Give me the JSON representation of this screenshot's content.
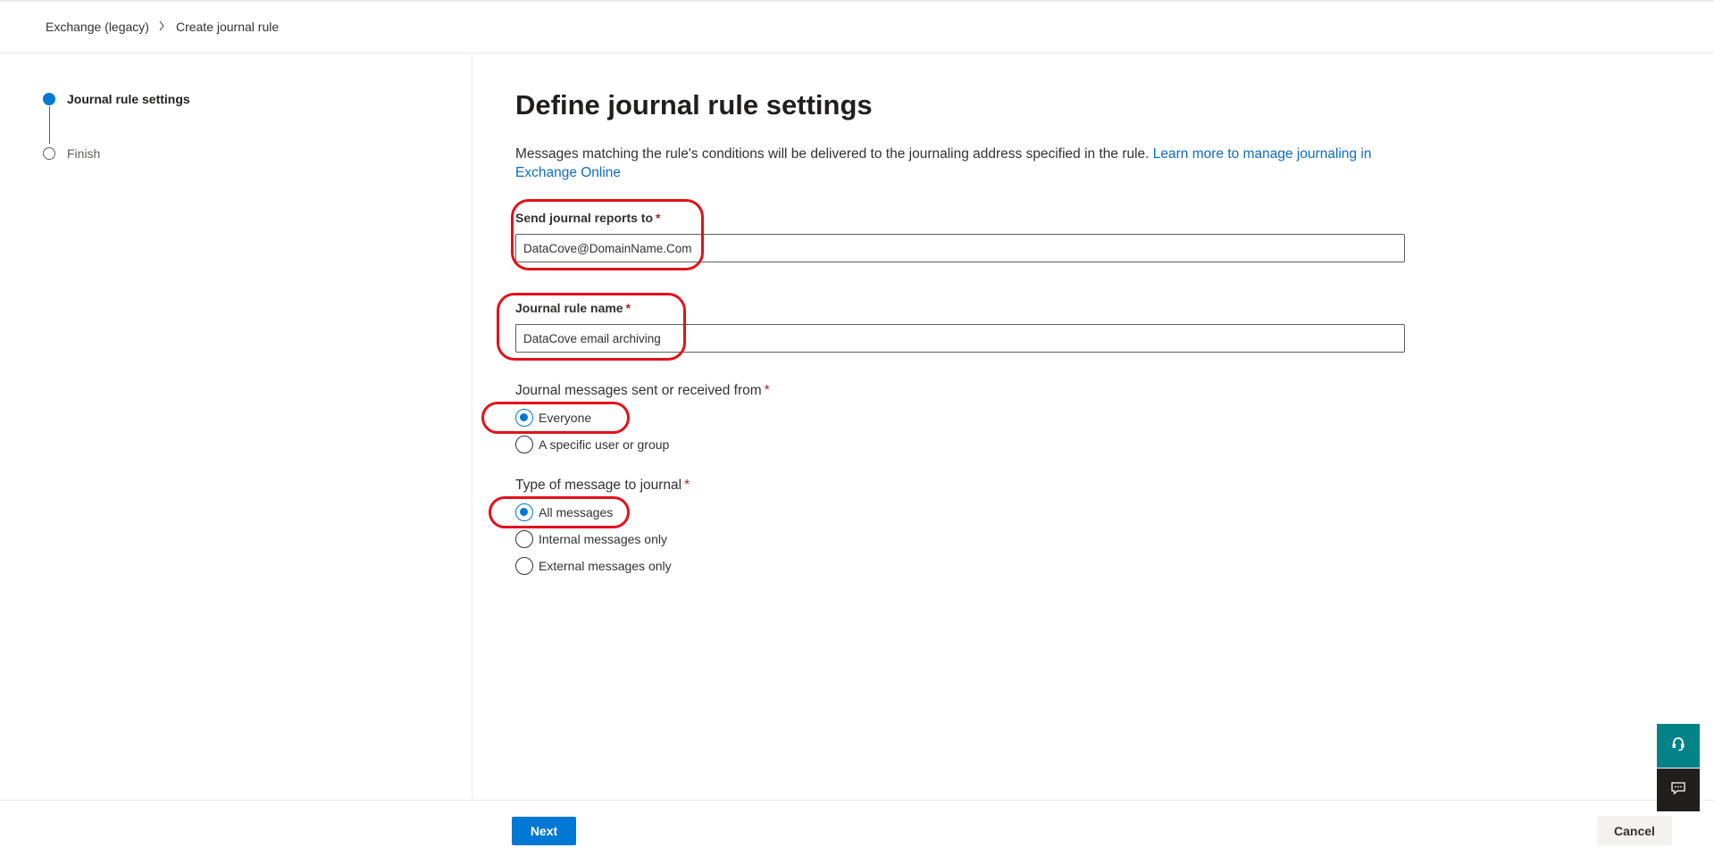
{
  "breadcrumb": {
    "items": [
      "Exchange (legacy)",
      "Create journal rule"
    ],
    "separator": ">"
  },
  "steps": [
    {
      "label": "Journal rule settings",
      "state": "active"
    },
    {
      "label": "Finish",
      "state": "pending"
    }
  ],
  "page": {
    "title": "Define journal rule settings",
    "description": "Messages matching the rule's conditions will be delivered to the journaling address specified in the rule. ",
    "learn_more_link": "Learn more to manage journaling in Exchange Online"
  },
  "form": {
    "send_reports": {
      "label": "Send journal reports to",
      "required": "*",
      "value": "DataCove@DomainName.Com"
    },
    "rule_name": {
      "label": "Journal rule name",
      "required": "*",
      "value": "DataCove email archiving"
    },
    "sender_scope": {
      "label": "Journal messages sent or received from",
      "required": "*",
      "options": [
        "Everyone",
        "A specific user or group"
      ],
      "selected": "Everyone"
    },
    "message_type": {
      "label": "Type of message to journal",
      "required": "*",
      "options": [
        "All messages",
        "Internal messages only",
        "External messages only"
      ],
      "selected": "All messages"
    }
  },
  "footer": {
    "next_label": "Next",
    "cancel_label": "Cancel"
  },
  "floating": {
    "help_icon": "headset-icon",
    "feedback_icon": "feedback-icon"
  },
  "colors": {
    "accent": "#0078d4",
    "annotation": "#e3111b",
    "help_button": "#038387"
  }
}
